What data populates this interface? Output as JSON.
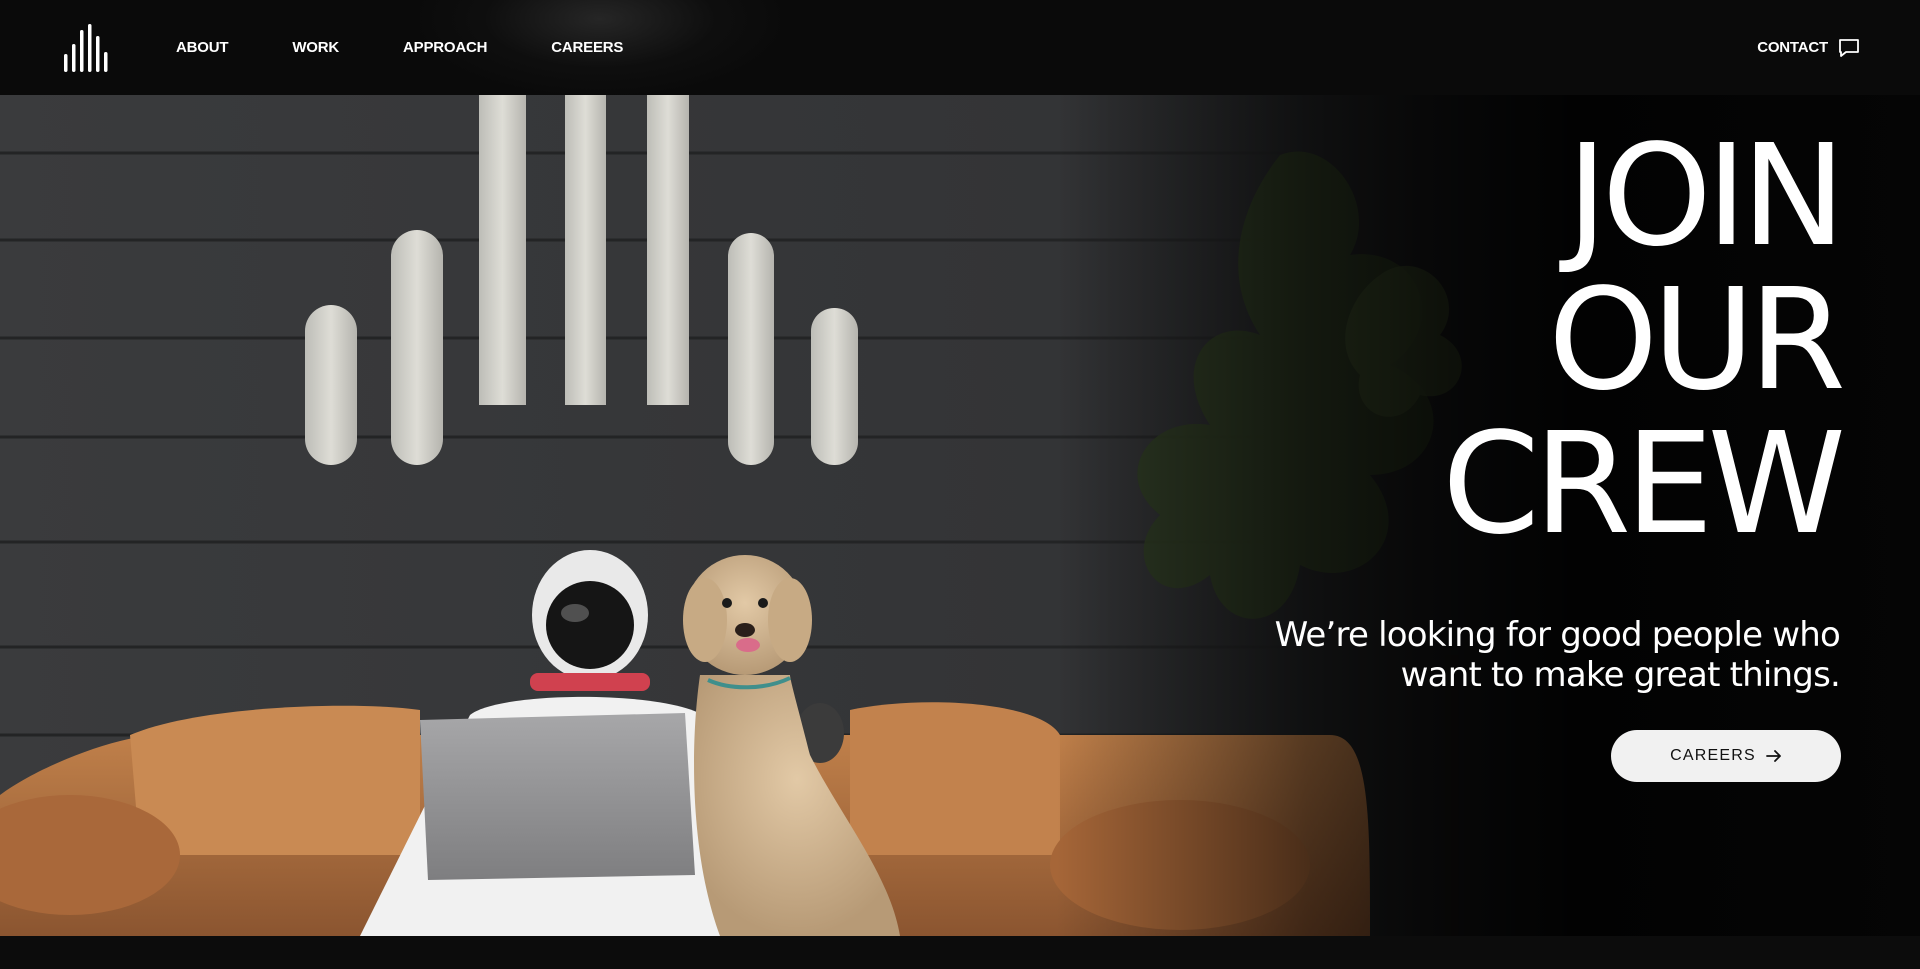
{
  "nav": {
    "logo_icon": "bars-logo-icon",
    "items": [
      {
        "label": "ABOUT"
      },
      {
        "label": "WORK"
      },
      {
        "label": "APPROACH"
      },
      {
        "label": "CAREERS"
      }
    ],
    "contact_label": "CONTACT",
    "contact_icon": "chat-bubble-icon"
  },
  "hero": {
    "title_lines": [
      "JOIN",
      "OUR",
      "CREW"
    ],
    "subtitle_line1": "We’re looking for good people who",
    "subtitle_line2": "want to make great things.",
    "cta_label": "CAREERS",
    "cta_icon": "arrow-right-icon",
    "image_icon": "astronaut-dog-photo"
  },
  "colors": {
    "background": "#0a0a0a",
    "text": "#ffffff",
    "button_bg": "#f1f1f1",
    "button_text": "#111111"
  }
}
